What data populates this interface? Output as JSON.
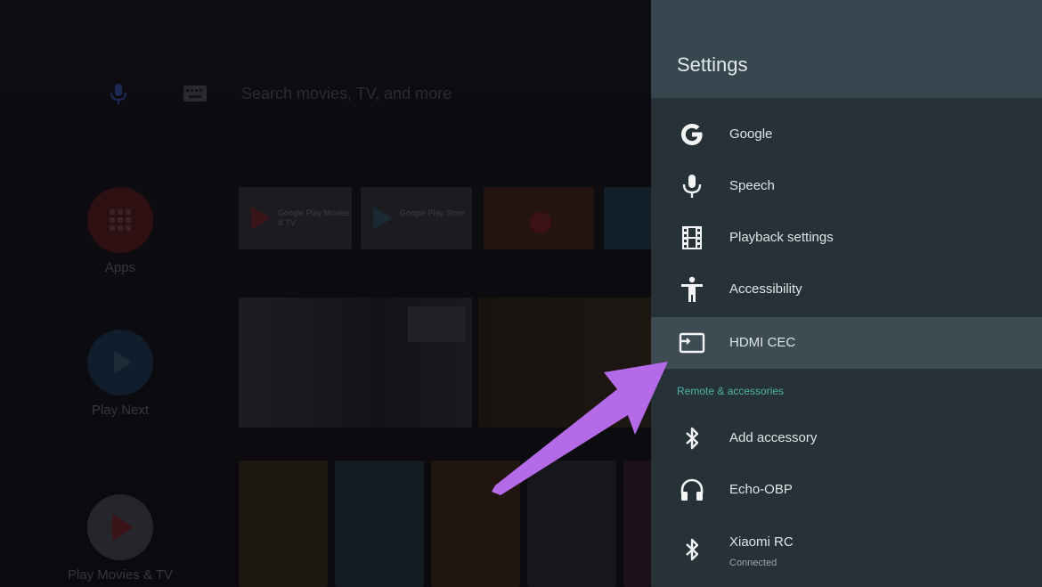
{
  "home": {
    "search_placeholder": "Search movies, TV, and more",
    "rail": [
      {
        "label": "Apps"
      },
      {
        "label": "Play Next"
      },
      {
        "label": "Play Movies & TV"
      }
    ],
    "cards": [
      {
        "title": "Google Play Movies & TV"
      },
      {
        "title": "Google Play Store"
      }
    ]
  },
  "settings": {
    "title": "Settings",
    "items": [
      {
        "label": "Google"
      },
      {
        "label": "Speech"
      },
      {
        "label": "Playback settings"
      },
      {
        "label": "Accessibility"
      },
      {
        "label": "HDMI CEC"
      }
    ],
    "section_header": "Remote & accessories",
    "accessories": [
      {
        "label": "Add accessory"
      },
      {
        "label": "Echo-OBP"
      },
      {
        "label": "Xiaomi RC",
        "status": "Connected"
      }
    ]
  },
  "colors": {
    "panel_bg": "#263238",
    "header_bg": "#37474f",
    "selected_bg": "#3d4b53",
    "section_accent": "#4fb3a9",
    "arrow": "#b56be8"
  }
}
